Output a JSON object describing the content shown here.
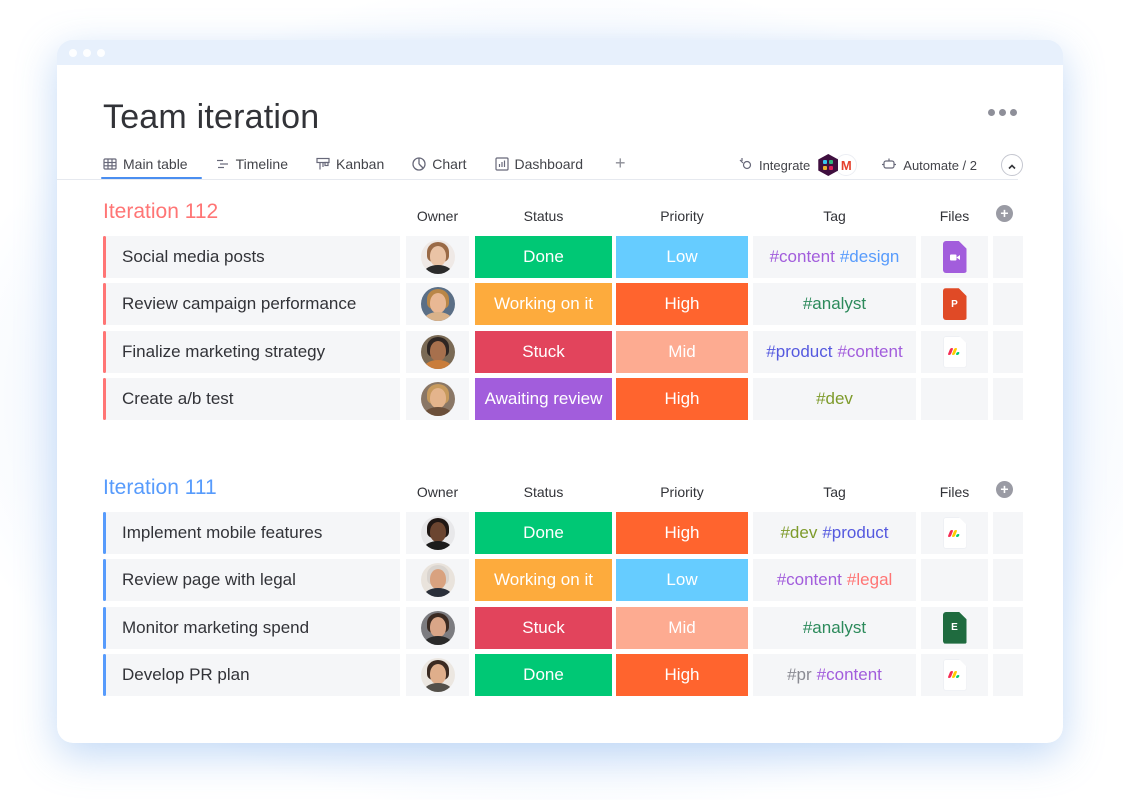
{
  "window": {
    "title": "Team iteration"
  },
  "views": {
    "tabs": [
      {
        "label": "Main table",
        "icon": "table-icon",
        "active": true
      },
      {
        "label": "Timeline",
        "icon": "timeline-icon",
        "active": false
      },
      {
        "label": "Kanban",
        "icon": "kanban-icon",
        "active": false
      },
      {
        "label": "Chart",
        "icon": "chart-icon",
        "active": false
      },
      {
        "label": "Dashboard",
        "icon": "dashboard-icon",
        "active": false
      }
    ],
    "add_label": "+"
  },
  "toolbar": {
    "integrate_label": "Integrate",
    "integrate_apps": [
      "slack",
      "gmail"
    ],
    "automate_label": "Automate / 2"
  },
  "columns": {
    "owner": "Owner",
    "status": "Status",
    "priority": "Priority",
    "tag": "Tag",
    "files": "Files",
    "add": "+"
  },
  "colors": {
    "status": {
      "Done": "#00c875",
      "Working on it": "#fdab3d",
      "Stuck": "#e2445c",
      "Awaiting review": "#a25ddc"
    },
    "priority": {
      "Low": "#66ccff",
      "High": "#ff642e",
      "Mid": "#fdab91"
    },
    "tags": {
      "#content": "#a25ddc",
      "#design": "#579bfc",
      "#analyst": "#2c8a5b",
      "#product": "#5559df",
      "#dev": "#7e9b2b",
      "#legal": "#ff7575",
      "#pr": "#8a8b93"
    }
  },
  "groups": [
    {
      "title": "Iteration 112",
      "color": "#ff7575",
      "rows": [
        {
          "name": "Social media posts",
          "owner": "avatar-woman-1",
          "status": "Done",
          "priority": "Low",
          "tags": [
            "#content",
            "#design"
          ],
          "file": "video"
        },
        {
          "name": "Review campaign performance",
          "owner": "avatar-woman-2",
          "status": "Working on it",
          "priority": "High",
          "tags": [
            "#analyst"
          ],
          "file": "powerpoint"
        },
        {
          "name": "Finalize marketing strategy",
          "owner": "avatar-man-1",
          "status": "Stuck",
          "priority": "Mid",
          "tags": [
            "#product",
            "#content"
          ],
          "file": "monday"
        },
        {
          "name": "Create a/b test",
          "owner": "avatar-woman-3",
          "status": "Awaiting review",
          "priority": "High",
          "tags": [
            "#dev"
          ],
          "file": ""
        }
      ]
    },
    {
      "title": "Iteration 111",
      "color": "#579bfc",
      "rows": [
        {
          "name": "Implement mobile features",
          "owner": "avatar-man-2",
          "status": "Done",
          "priority": "High",
          "tags": [
            "#dev",
            "#product"
          ],
          "file": "monday"
        },
        {
          "name": "Review page with legal",
          "owner": "avatar-man-3",
          "status": "Working on it",
          "priority": "Low",
          "tags": [
            "#content",
            "#legal"
          ],
          "file": ""
        },
        {
          "name": "Monitor marketing spend",
          "owner": "avatar-woman-4",
          "status": "Stuck",
          "priority": "Mid",
          "tags": [
            "#analyst"
          ],
          "file": "excel"
        },
        {
          "name": "Develop PR plan",
          "owner": "avatar-woman-5",
          "status": "Done",
          "priority": "High",
          "tags": [
            "#pr",
            "#content"
          ],
          "file": "monday"
        }
      ]
    }
  ],
  "file_labels": {
    "powerpoint": "P",
    "excel": "E"
  }
}
